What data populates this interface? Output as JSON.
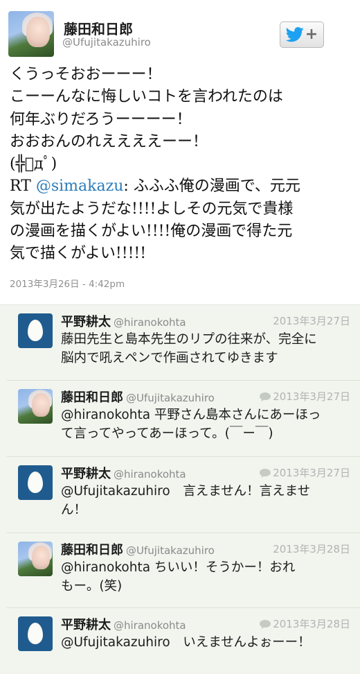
{
  "main_tweet": {
    "display_name": "藤田和日郎",
    "username": "@Ufujitakazuhiro",
    "text_lines": [
      "くうっそおおーーー！",
      "こーーんなに悔しいコトを言われたのは",
      "何年ぶりだろうーーーー！",
      "おおおんのれええええーー！",
      "(╬ﾟдﾟ)"
    ],
    "rt_prefix": "RT ",
    "rt_mention": "@simakazu",
    "rt_lines": [
      ": ふふふ俺の漫画で、元元",
      "気が出たようだな!!!!よしその元気で貴様",
      "の漫画を描くがよい!!!!俺の漫画で得た元",
      "気で描くがよい!!!!!"
    ],
    "timestamp": "2013年3月26日 - 4:42pm",
    "follow_button": {
      "label": "+",
      "icon": "twitter-bird-icon",
      "color": "#1da1f2"
    }
  },
  "replies": [
    {
      "avatar": "egg-avatar",
      "name": "平野耕太",
      "handle": "@hiranokohta",
      "date": "2013年3月27日",
      "is_reply": false,
      "text_lines": [
        "藤田先生と島本先生のリプの往来が、完全に",
        "脳内で吼えペンで作画されてゆきます"
      ]
    },
    {
      "avatar": "photo-avatar",
      "name": "藤田和日郎",
      "handle": "@Ufujitakazuhiro",
      "date": "2013年3月27日",
      "is_reply": true,
      "text_lines": [
        "@hiranokohta 平野さん島本さんにあーほっ",
        "て言ってやってあーほって。(￣ー￣)"
      ]
    },
    {
      "avatar": "egg-avatar",
      "name": "平野耕太",
      "handle": "@hiranokohta",
      "date": "2013年3月27日",
      "is_reply": true,
      "text_lines": [
        "@Ufujitakazuhiro　言えません！言えませ",
        "ん！"
      ]
    },
    {
      "avatar": "photo-avatar",
      "name": "藤田和日郎",
      "handle": "@Ufujitakazuhiro",
      "date": "2013年3月28日",
      "is_reply": false,
      "text_lines": [
        "@hiranokohta ちいい！そうかー！おれ",
        "もー。(笑)"
      ]
    },
    {
      "avatar": "egg-avatar",
      "name": "平野耕太",
      "handle": "@hiranokohta",
      "date": "2013年3月28日",
      "is_reply": true,
      "text_lines": [
        "@Ufujitakazuhiro　いえませんよぉーー！"
      ]
    }
  ],
  "colors": {
    "link": "#2b7bb9",
    "egg_background": "#1f5b8e",
    "reply_background": "#f1f5ee"
  }
}
